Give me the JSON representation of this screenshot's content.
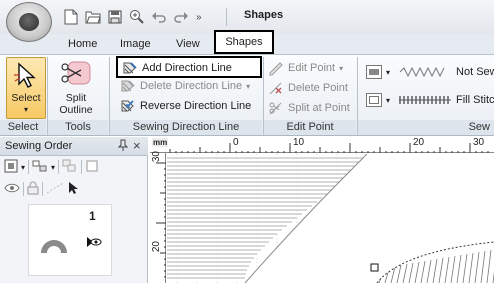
{
  "window": {
    "title": "Shapes"
  },
  "quick_access": {
    "more": "»"
  },
  "tabs": [
    "Home",
    "Image",
    "View",
    "Shapes"
  ],
  "ribbon": {
    "select": {
      "label": "Select",
      "group": "Select"
    },
    "tools": {
      "label_line1": "Split",
      "label_line2": "Outline",
      "group": "Tools"
    },
    "sewing_direction": {
      "group": "Sewing Direction Line",
      "add": "Add Direction Line",
      "delete": "Delete Direction Line",
      "reverse": "Reverse Direction Line"
    },
    "edit_point": {
      "group": "Edit Point",
      "edit": "Edit Point",
      "delete": "Delete Point",
      "split": "Split at Point"
    },
    "sew": {
      "group": "Sew",
      "line_sew": "Not Sew",
      "fill_stitch": "Fill Stitch"
    }
  },
  "panel": {
    "title": "Sewing Order",
    "pin": "ᵖ",
    "close": "×",
    "item_number": "1"
  },
  "ruler": {
    "unit": "mm",
    "top_labels": [
      "0",
      "10",
      "20",
      "30"
    ],
    "left_labels": [
      "30",
      "20"
    ]
  },
  "colors": {
    "ribbon_bg": "#e9eef4",
    "highlight_border": "#000000"
  }
}
